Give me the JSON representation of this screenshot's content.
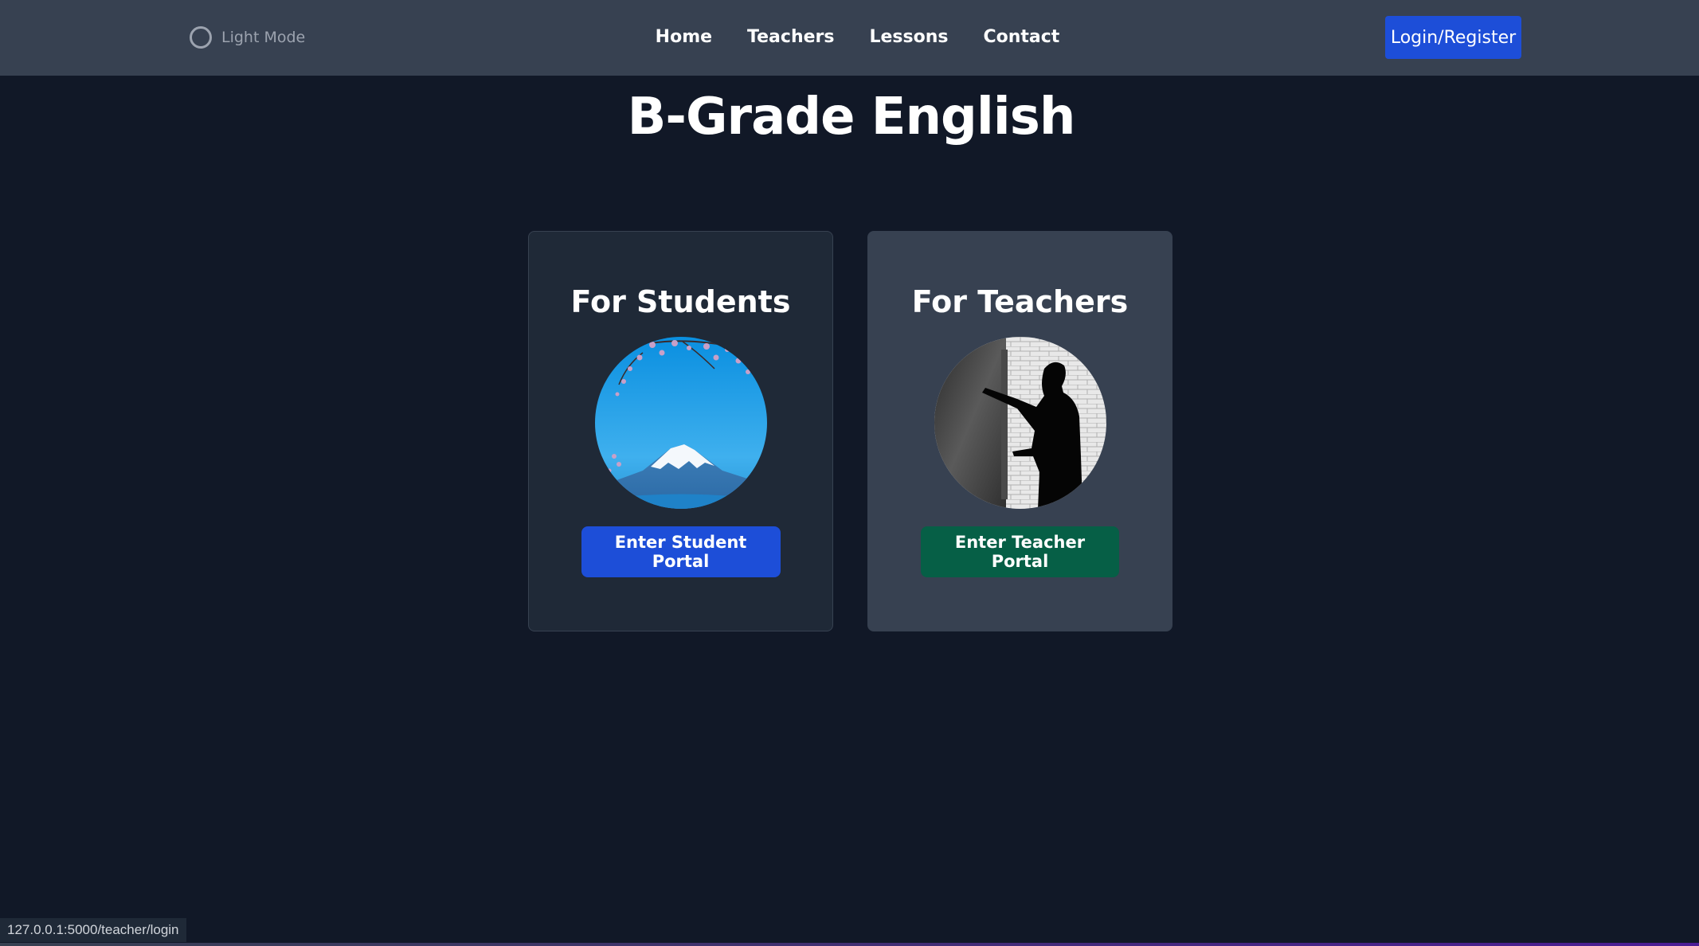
{
  "nav": {
    "theme_toggle_label": "Light Mode",
    "links": [
      "Home",
      "Teachers",
      "Lessons",
      "Contact"
    ],
    "login_label": "Login/Register"
  },
  "main": {
    "title": "B-Grade English",
    "cards": [
      {
        "heading": "For Students",
        "image": "mount-fuji-cherry-blossom",
        "button": "Enter Student Portal",
        "button_color": "#1d4ed8"
      },
      {
        "heading": "For Teachers",
        "image": "teacher-silhouette-chalkboard",
        "button": "Enter Teacher Portal",
        "button_color": "#065f46"
      }
    ]
  },
  "status_bar": {
    "url": "127.0.0.1:5000/teacher/login"
  },
  "colors": {
    "background": "#111827",
    "navbar": "#374151",
    "primary": "#1d4ed8",
    "teacher": "#065f46"
  }
}
